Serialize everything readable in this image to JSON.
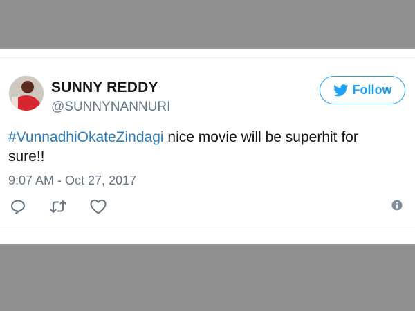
{
  "tweet": {
    "author": {
      "display_name": "SUNNY REDDY",
      "handle": "@SUNNYNANNURI"
    },
    "follow_label": "Follow",
    "hashtag": "#VunnadhiOkateZindagi",
    "text": " nice movie will be superhit for sure!!",
    "timestamp": "9:07 AM - Oct 27, 2017"
  },
  "icons": {
    "follow": "twitter-bird-icon",
    "reply": "reply-icon",
    "retweet": "retweet-icon",
    "like": "heart-icon",
    "info": "info-icon"
  },
  "colors": {
    "accent": "#1da1f2",
    "hashtag": "#2b7bb9",
    "background_band": "#8f8f8f",
    "muted_text": "#657786",
    "icon": "#657786"
  }
}
